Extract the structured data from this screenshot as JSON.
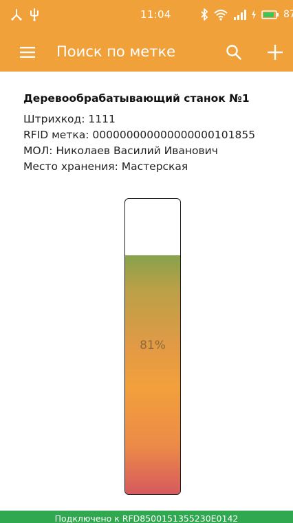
{
  "status_bar": {
    "time": "11:04",
    "battery_level": "87",
    "left_icons": [
      "fork-icon",
      "usb-icon"
    ],
    "right_icons": [
      "bluetooth-icon",
      "wifi-icon",
      "cell-signal-icon",
      "charging-icon",
      "battery-icon"
    ]
  },
  "toolbar": {
    "title": "Поиск по метке",
    "menu_icon": "hamburger-menu-icon",
    "search_icon": "search-icon",
    "add_icon": "plus-icon"
  },
  "item": {
    "name": "Деревообрабатывающий станок №1",
    "barcode": "Штрихкод: 1111",
    "rfid": "RFID метка: 000000000000000000101855",
    "mol": "МОЛ: Николаев Василий Иванович",
    "location": "Место хранения: Мастерская"
  },
  "gauge": {
    "level_percent": 81,
    "label": "81%"
  },
  "connection": {
    "text": "Подключено к RFD8500151355230E0142"
  },
  "colors": {
    "accent": "#f1a13a",
    "connected": "#2fa84f",
    "gauge_top": "#87a24b",
    "gauge_mid": "#f2a03c",
    "gauge_bottom": "#d55a5e"
  }
}
